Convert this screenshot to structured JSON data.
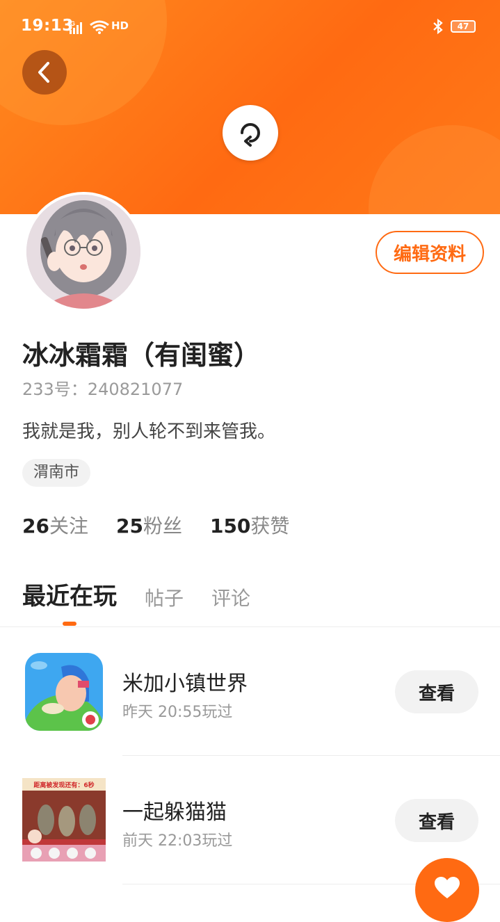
{
  "status_bar": {
    "time": "19:13",
    "network": "4G",
    "hd": "HD",
    "battery": "47"
  },
  "header": {
    "back_icon": "back-arrow-icon",
    "refresh_icon": "refresh-icon"
  },
  "profile": {
    "edit_label": "编辑资料",
    "username": "冰冰霜霜（有闺蜜）",
    "uid": "233号：240821077",
    "bio": "我就是我，别人轮不到来管我。",
    "location": "渭南市",
    "stats": [
      {
        "count": "26",
        "label": "关注"
      },
      {
        "count": "25",
        "label": "粉丝"
      },
      {
        "count": "150",
        "label": "获赞"
      }
    ]
  },
  "tabs": [
    {
      "label": "最近在玩",
      "active": true
    },
    {
      "label": "帖子",
      "active": false
    },
    {
      "label": "评论",
      "active": false
    }
  ],
  "games": [
    {
      "name": "米加小镇世界",
      "played": "昨天 20:55玩过",
      "button": "查看"
    },
    {
      "name": "一起躲猫猫",
      "played": "前天 22:03玩过",
      "button": "查看"
    }
  ],
  "game2_banner": "距离被发现还有：6秒",
  "fab_icon": "heart-icon",
  "colors": {
    "accent": "#ff6a12",
    "header_start": "#ff8a1f"
  }
}
